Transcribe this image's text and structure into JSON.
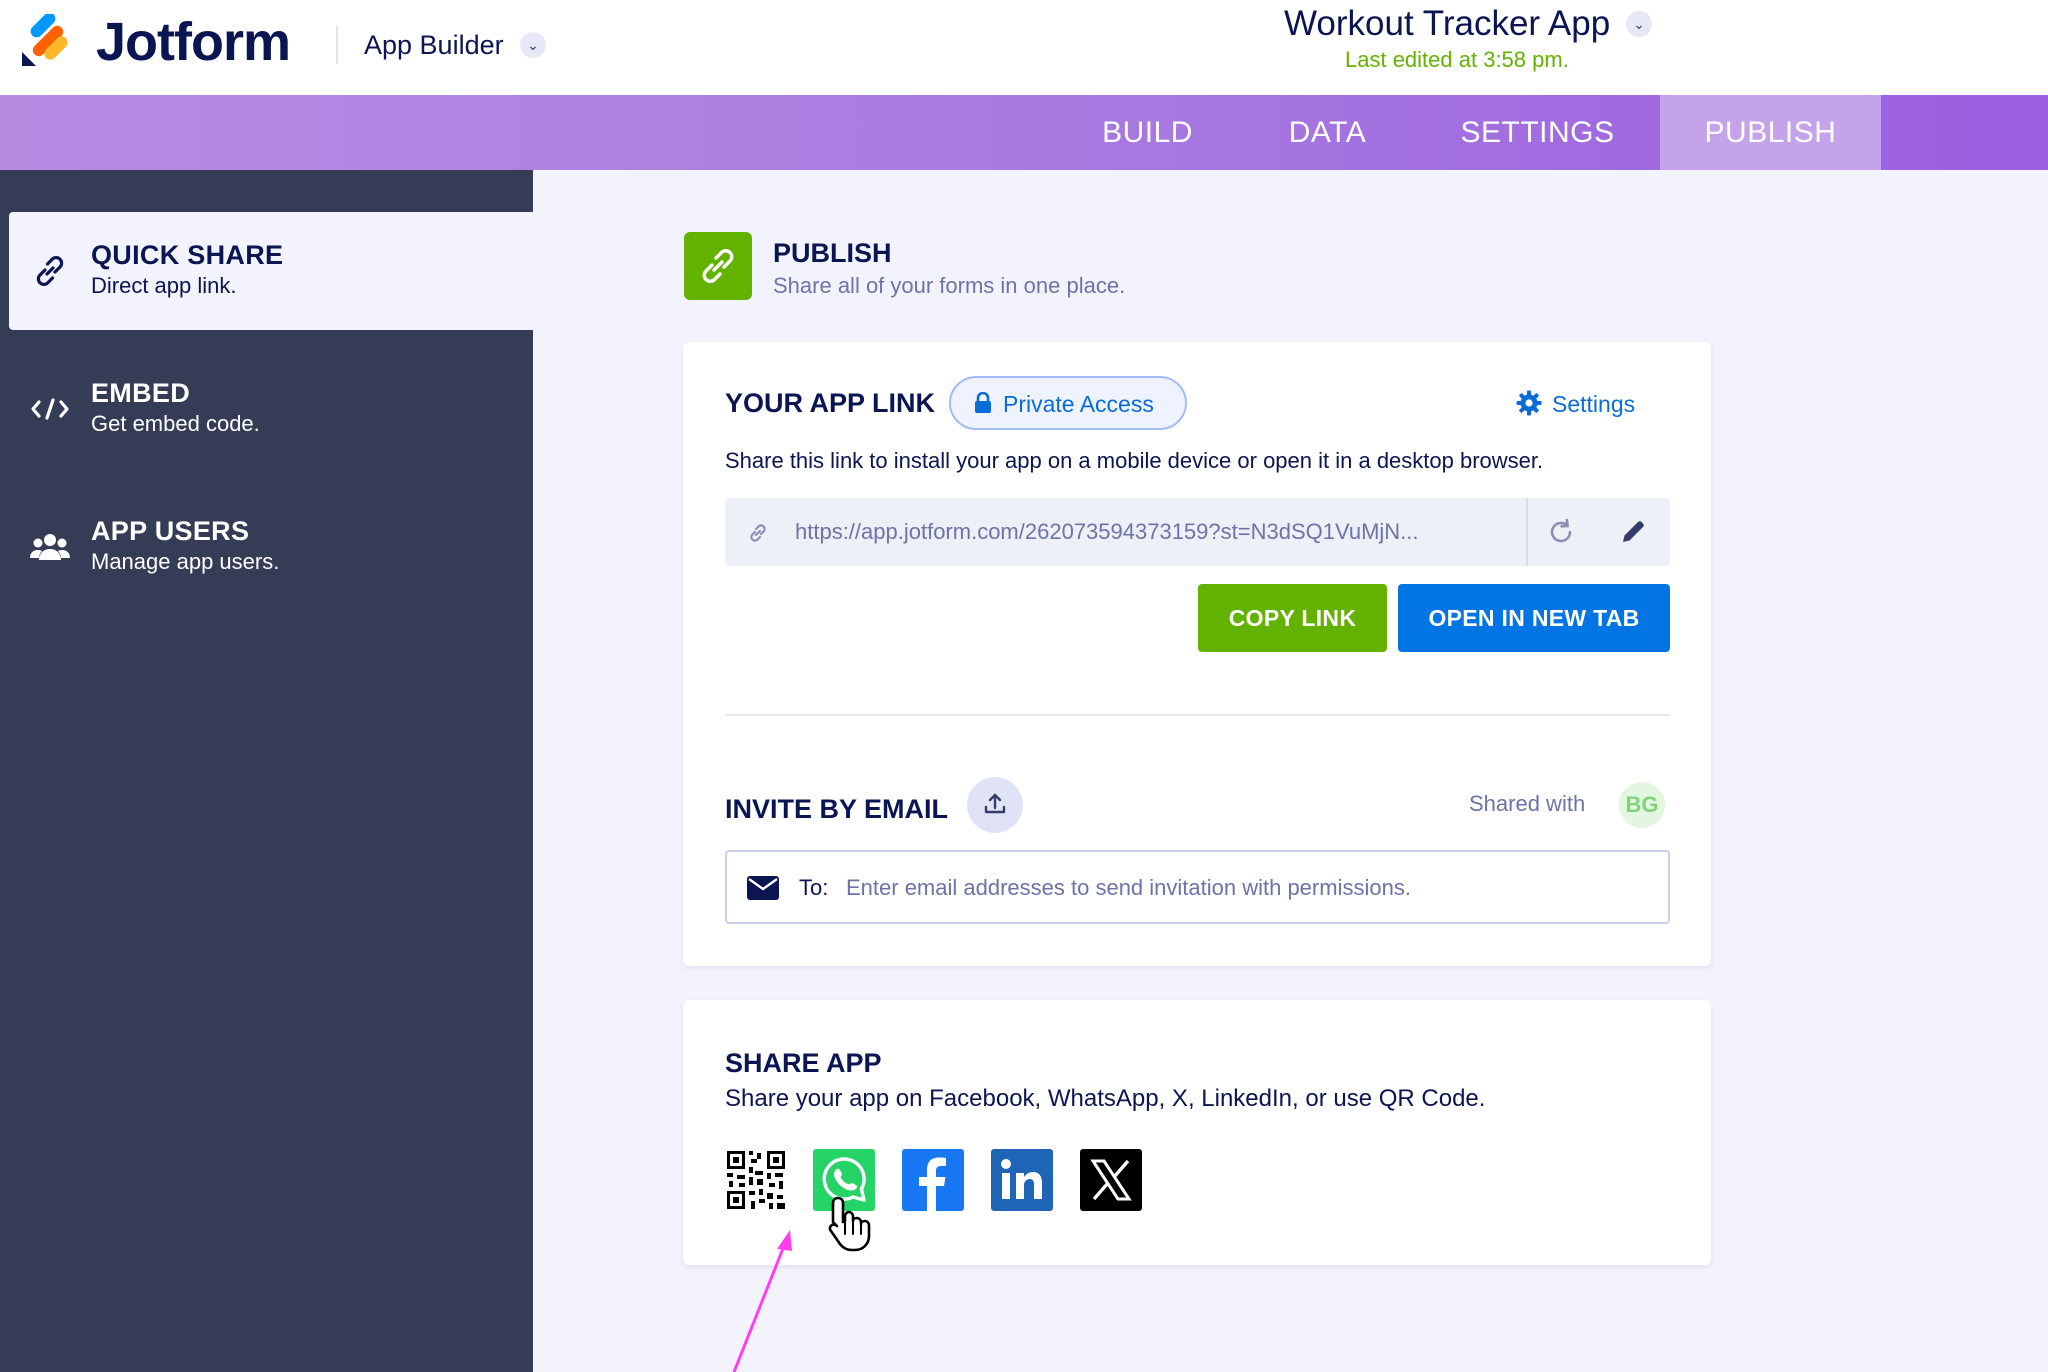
{
  "header": {
    "brand": "Jotform",
    "product": "App Builder",
    "app_title": "Workout Tracker App",
    "last_edited": "Last edited at 3:58 pm."
  },
  "nav": {
    "tabs": [
      {
        "label": "BUILD"
      },
      {
        "label": "DATA"
      },
      {
        "label": "SETTINGS"
      },
      {
        "label": "PUBLISH",
        "active": true
      }
    ]
  },
  "sidebar": {
    "items": [
      {
        "title": "QUICK SHARE",
        "subtitle": "Direct app link.",
        "icon": "link-icon",
        "active": true
      },
      {
        "title": "EMBED",
        "subtitle": "Get embed code.",
        "icon": "code-icon"
      },
      {
        "title": "APP USERS",
        "subtitle": "Manage app users.",
        "icon": "users-icon"
      }
    ]
  },
  "publish": {
    "title": "PUBLISH",
    "subtitle": "Share all of your forms in one place."
  },
  "app_link": {
    "title": "YOUR APP LINK",
    "access_badge": "Private Access",
    "settings_label": "Settings",
    "description": "Share this link to install your app on a mobile device or open it in a desktop browser.",
    "url": "https://app.jotform.com/262073594373159?st=N3dSQ1VuMjN...",
    "copy_label": "COPY LINK",
    "open_label": "OPEN IN NEW TAB"
  },
  "invite": {
    "title": "INVITE BY EMAIL",
    "shared_with_label": "Shared with",
    "avatar_initials": "BG",
    "to_label": "To:",
    "placeholder": "Enter email addresses to send invitation with permissions."
  },
  "share_app": {
    "title": "SHARE APP",
    "subtitle": "Share your app on Facebook, WhatsApp, X, LinkedIn, or use QR Code.",
    "icons": [
      "qr-code-icon",
      "whatsapp-icon",
      "facebook-icon",
      "linkedin-icon",
      "x-icon"
    ]
  },
  "colors": {
    "accent_green": "#64b200",
    "accent_blue": "#0075e3",
    "navy": "#0a1551",
    "sidebar_bg": "#343c56",
    "nav_purple": "#a779e0",
    "annotation_arrow": "#ff3ef0"
  }
}
